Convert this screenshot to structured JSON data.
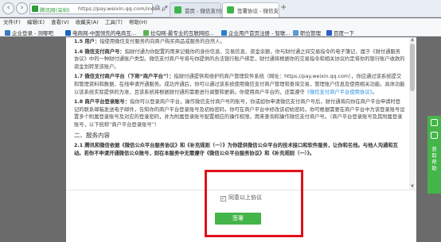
{
  "browser": {
    "nav_back_glyph": "‹",
    "nav_forward_glyph": "›",
    "address": {
      "site_name": "腾讯网(深圳)",
      "url": "https://pay.weixin.qq.com/index.p"
    },
    "address_buttons": "⟳ ▾",
    "tabs": [
      {
        "label": "首页 - 微信支付商户平...",
        "active": false
      },
      {
        "label": "签署协议 - 微信支付商户平...",
        "active": true
      }
    ],
    "new_tab_glyph": "+",
    "menu": [
      "文件(F)",
      "编辑(E)",
      "查看(V)",
      "收藏夹(A)",
      "工具(T)",
      "帮助(H)"
    ],
    "favorites": [
      {
        "label": "企业登录 - 测哪吧",
        "color": "#3a78c8"
      },
      {
        "label": "电商网-中国领先的电商互...",
        "color": "#1565c0"
      },
      {
        "label": "拉勾网-最专业的互联网招...",
        "color": "#5ab552"
      },
      {
        "label": "企业用户首页注册 - 智联...",
        "color": "#2a7fd5"
      },
      {
        "label": "职位管理",
        "color": "#5b9bd5"
      },
      {
        "label": "百度一下",
        "color": "#2e5bce"
      }
    ]
  },
  "agreement": {
    "clauses": [
      {
        "lead": "1.5 用户：",
        "text": "指使用微信支付服务的向商户购买商品或服务的自然人。"
      },
      {
        "lead": "1.6 微信支付商户号：",
        "text": "指财付通为你配置的用来记载你的身份信息、交易信息、资金余额，你与财付通之间交易指令的电子簿记，属于《财付通服务协议》中的一种财付通账户类型。微信支付商户号将与你提供的合法银行账户绑定，财付通将根据你的交易指令和相关协议约定将你的银行账户收款的资金划转至该账户。"
      },
      {
        "lead": "1.7 微信支付商户平台（下称“商户平台”）：",
        "text": "指财付通提供和维护的商户管理软件系统（网址：https://pay.weixin.qq.com），你应通过该系统提交和管理资料和数据，在线申请开通服务。成功开通后，你可以通过该系统使用微信支付商户管理和查询交易，管理账户信息及使用相关功能。具体功能以该系统实际提供的为准，且该系统将根据财付通的需要进行调整和更新。你使用商户平台的，还需遵守",
        "link": "《微信支付商户平台使用协议》",
        "tail": "。"
      },
      {
        "lead": "1.8 商户平台登录账号：",
        "text": "指你可以登录商户平台，操作微信支付商户号的账号，你或如你申请微信支付商户号后，财付通将向你在商户平台申请时登记的联系邮箱发送电子邮件，告知你的商户平台登录账号及初始密码，你可在商户平台中修改该初始密码，你可根据需要在商户平台中为该登录账号设置多个附属登录账号及对应的登录密码，并为附属登录账号配置相应的操作权限，用来查询和操作微信支付商户号。（商户平台登录账号及其附属登录账号，以下统称“商户平台登录账号”）"
      }
    ],
    "section_title": "二、服务内容",
    "section_clause": {
      "lead": "2.1 腾讯和微信依据《微信公众平台服务协议》和《补充规则（一）》为你提供微信公众平台的技术接口和软件服务，",
      "text": "让你和名他。与他人沟通和互动。若你不申请开通微信公众账号，则在本服务中无需遵守《微信公众平台服务协议》和《补充规则（一）》。"
    },
    "agree_checkbox_mark": "✓",
    "agree_label": "同意以上协议",
    "sign_button": "签署"
  },
  "side_widget": {
    "label": "获取帮助"
  }
}
